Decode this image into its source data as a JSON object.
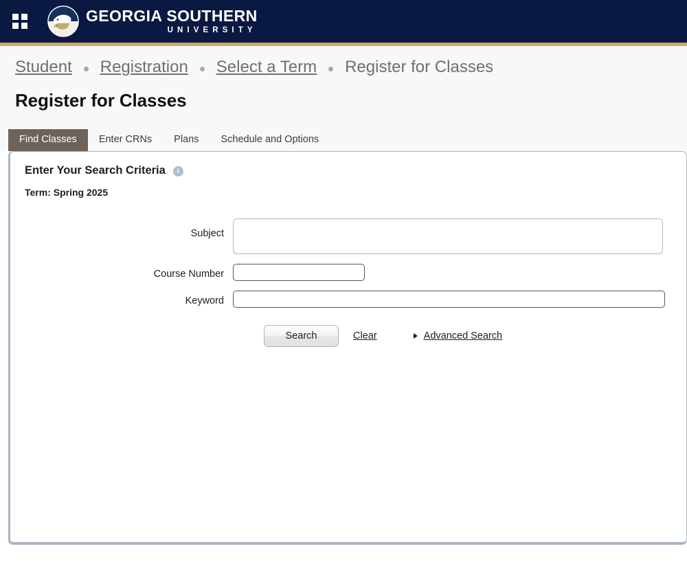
{
  "header": {
    "menu_icon": "grid-apps-icon",
    "logo_icon": "georgia-southern-eagle-seal-icon",
    "brand_main": "GEORGIA SOUTHERN",
    "brand_sub": "UNIVERSITY",
    "bar_color": "#0a1942",
    "accent_color": "#cfa862"
  },
  "breadcrumb": {
    "items": [
      {
        "label": "Student",
        "link": true
      },
      {
        "label": "Registration",
        "link": true
      },
      {
        "label": "Select a Term",
        "link": true
      },
      {
        "label": "Register for Classes",
        "link": false
      }
    ]
  },
  "page": {
    "title": "Register for Classes"
  },
  "tabs": [
    {
      "label": "Find Classes",
      "active": true
    },
    {
      "label": "Enter CRNs",
      "active": false
    },
    {
      "label": "Plans",
      "active": false
    },
    {
      "label": "Schedule and Options",
      "active": false
    }
  ],
  "panel": {
    "heading": "Enter Your Search Criteria",
    "info_icon": "information-icon",
    "info_glyph": "i",
    "term_line": "Term: Spring 2025",
    "active_tab_color": "#6f6259",
    "border_color": "#a8b4c4"
  },
  "form": {
    "subject": {
      "label": "Subject",
      "value": "",
      "placeholder": ""
    },
    "course_number": {
      "label": "Course Number",
      "value": "",
      "placeholder": ""
    },
    "keyword": {
      "label": "Keyword",
      "value": "",
      "placeholder": ""
    },
    "search_label": "Search",
    "clear_label": "Clear",
    "advanced_search_label": "Advanced Search",
    "advanced_caret_icon": "caret-right-icon"
  }
}
